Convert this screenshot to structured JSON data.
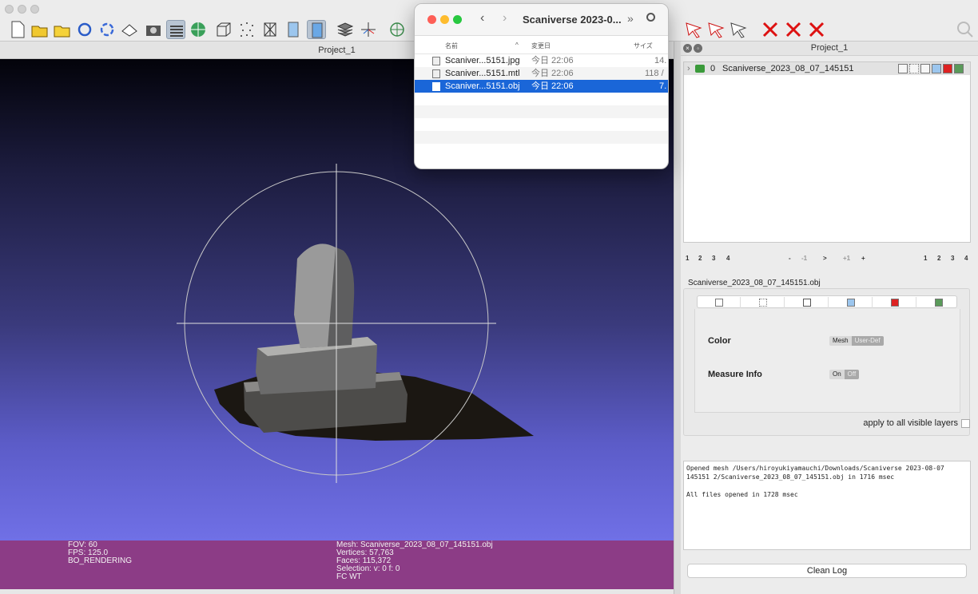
{
  "window": {
    "project_title": "Project_1"
  },
  "toolbar": {
    "icons": [
      "new-project-icon",
      "open-project-icon",
      "open-mesh-icon",
      "reload-icon",
      "reload-all-icon",
      "save-icon",
      "snapshot-icon",
      "layers-icon",
      "gl-info-icon",
      "bounding-box-icon",
      "points-icon",
      "wireframe-icon",
      "flat-icon",
      "smooth-icon",
      "texture-icon",
      "axis-icon",
      "trackball-icon",
      "select-faces-icon",
      "select-vertices-icon",
      "select-connected-icon",
      "delete-faces-icon",
      "delete-vertices-icon",
      "delete-all-icon",
      "search-icon"
    ]
  },
  "viewport": {
    "fov": "FOV: 60",
    "fps": "FPS:   125.0",
    "rendering": "BO_RENDERING",
    "mesh": "Mesh: Scaniverse_2023_08_07_145151.obj",
    "vertices": "Vertices: 57,763",
    "faces": "Faces: 115,372",
    "selection": "Selection: v: 0 f: 0",
    "flags": "FC WT"
  },
  "finder": {
    "title": "Scaniverse 2023-0...",
    "col_name": "名前",
    "col_date": "変更日",
    "col_size": "サイズ",
    "files": [
      {
        "name": "Scaniver...5151.jpg",
        "date": "今日 22:06",
        "size": "14.",
        "selected": false
      },
      {
        "name": "Scaniver...5151.mtl",
        "date": "今日 22:06",
        "size": "118 /",
        "selected": false
      },
      {
        "name": "Scaniver...5151.obj",
        "date": "今日 22:06",
        "size": "7.",
        "selected": true
      }
    ]
  },
  "panel": {
    "title": "Project_1",
    "layer": {
      "index": "0",
      "name": "Scaniverse_2023_08_07_145151"
    },
    "pager_left": [
      "1",
      "2",
      "3",
      "4"
    ],
    "pager_mid": [
      "-",
      "-1",
      ">",
      "+1",
      "+"
    ],
    "pager_right": [
      "1",
      "2",
      "3",
      "4"
    ],
    "mesh_name": "Scaniverse_2023_08_07_145151.obj",
    "color_label": "Color",
    "color_options": [
      "Mesh",
      "User-Def"
    ],
    "measure_label": "Measure Info",
    "measure_options": [
      "On",
      "Off"
    ],
    "apply_all": "apply to all visible layers",
    "log_lines": "Opened mesh /Users/hiroyukiyamauchi/Downloads/Scaniverse 2023-08-07\n145151 2/Scaniverse_2023_08_07_145151.obj in 1716 msec\n\nAll files opened in 1728 msec",
    "clear_log": "Clean Log"
  }
}
